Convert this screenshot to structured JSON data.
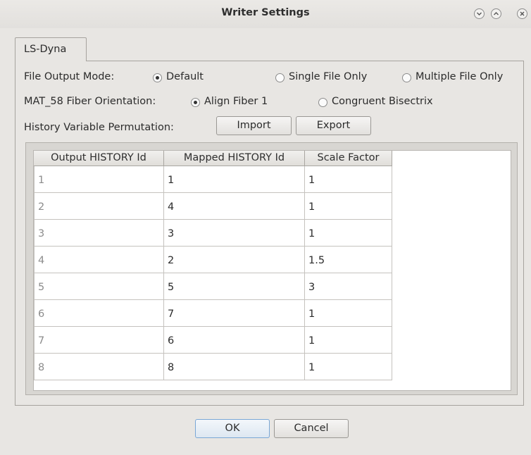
{
  "window": {
    "title": "Writer Settings",
    "controls": [
      "minimize-icon",
      "maximize-icon",
      "close-icon"
    ]
  },
  "tabs": [
    {
      "label": "LS-Dyna",
      "active": true
    }
  ],
  "file_output_mode": {
    "label": "File Output Mode:",
    "options": [
      {
        "label": "Default",
        "selected": true
      },
      {
        "label": "Single File Only",
        "selected": false
      },
      {
        "label": "Multiple File Only",
        "selected": false
      }
    ]
  },
  "fiber_orientation": {
    "label": "MAT_58 Fiber Orientation:",
    "options": [
      {
        "label": "Align Fiber 1",
        "selected": true
      },
      {
        "label": "Congruent Bisectrix",
        "selected": false
      }
    ]
  },
  "history_permutation": {
    "label": "History Variable Permutation:",
    "import_label": "Import",
    "export_label": "Export"
  },
  "table": {
    "columns": [
      "Output HISTORY Id",
      "Mapped HISTORY Id",
      "Scale Factor"
    ],
    "rows": [
      [
        "1",
        "1",
        "1"
      ],
      [
        "2",
        "4",
        "1"
      ],
      [
        "3",
        "3",
        "1"
      ],
      [
        "4",
        "2",
        "1.5"
      ],
      [
        "5",
        "5",
        "3"
      ],
      [
        "6",
        "7",
        "1"
      ],
      [
        "7",
        "6",
        "1"
      ],
      [
        "8",
        "8",
        "1"
      ]
    ]
  },
  "footer": {
    "ok_label": "OK",
    "cancel_label": "Cancel"
  }
}
